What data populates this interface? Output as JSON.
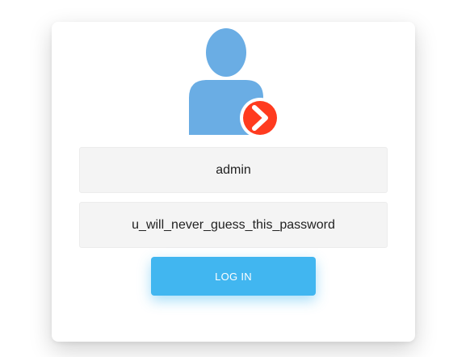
{
  "login_form": {
    "avatar_icon": "user-login-icon",
    "username_value": "admin",
    "password_value": "u_will_never_guess_this_password",
    "login_button_label": "LOG IN"
  },
  "colors": {
    "avatar": "#6aade4",
    "badge": "#ff3b1f",
    "button": "#41b6f0",
    "field_background": "#f4f4f4"
  }
}
